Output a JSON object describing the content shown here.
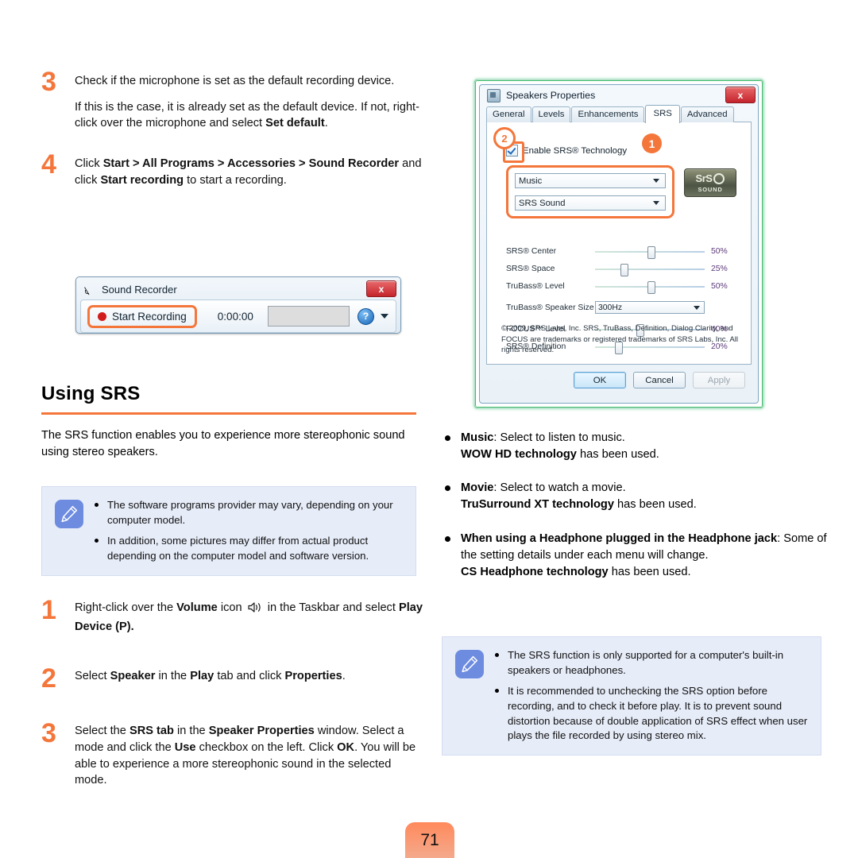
{
  "page": {
    "number": "71"
  },
  "left_column": {
    "step3": {
      "num": "3",
      "line1": "Check if the microphone is set as the default recording device.",
      "line2_a": "If this is the case, it is already set as the default device. If not, right-click over the microphone and select ",
      "line2_b": "Set default",
      "line2_c": "."
    },
    "step4": {
      "num": "4",
      "a": "Click ",
      "b": "Start > All Programs > Accessories > Sound Recorder",
      "c": " and click ",
      "d": "Start recording",
      "e": " to start a recording."
    }
  },
  "sound_recorder": {
    "title": "Sound Recorder",
    "close_label": "x",
    "record_button": "Start Recording",
    "record_button_accesskey": "S",
    "time": "0:00:00",
    "help_label": "?"
  },
  "using_srs": {
    "heading": "Using SRS",
    "paragraph": "The SRS function enables you to experience more stereophonic sound using stereo speakers.",
    "note": {
      "icon": "pencil-note-icon",
      "items": [
        "The software programs provider may vary, depending on your computer model.",
        "In addition, some pictures may differ from actual product depending on the computer model and software version."
      ]
    },
    "steps": [
      {
        "num": "1",
        "a": "Right-click over the ",
        "b": "Volume",
        "c": " icon ",
        "icon": "volume-speaker-icon",
        "d": " in the Taskbar and select ",
        "e": "Play Device (P).",
        "f": ""
      },
      {
        "num": "2",
        "a": "Select ",
        "b": "Speaker",
        "c": " in the ",
        "d": "Play",
        "e": " tab and click ",
        "f": "Properties",
        "g": "."
      },
      {
        "num": "3",
        "a": "Select the ",
        "b": "SRS tab",
        "c": " in the ",
        "d": "Speaker Properties",
        "e": " window. Select a mode and click the ",
        "f": "Use",
        "g": " checkbox on the left. Click ",
        "h": "OK",
        "i": ". You will be able to experience a more stereophonic sound in the selected mode."
      }
    ]
  },
  "speakers_properties": {
    "window_title": "Speakers Properties",
    "app_icon": "speaker-properties-icon",
    "close_label": "x",
    "tabs": [
      {
        "label": "General",
        "selected": false
      },
      {
        "label": "Levels",
        "selected": false
      },
      {
        "label": "Enhancements",
        "selected": false
      },
      {
        "label": "SRS",
        "selected": true
      },
      {
        "label": "Advanced",
        "selected": false
      }
    ],
    "enable_checkbox_label": "Enable SRS® Technology",
    "enable_checked": true,
    "callout_1": "1",
    "callout_2": "2",
    "mode_combo": "Music",
    "effect_combo": "SRS Sound",
    "logo": {
      "mark": "SrS",
      "sub": "SOUND"
    },
    "sliders": [
      {
        "label": "SRS® Center",
        "value": "50%",
        "pct": 50
      },
      {
        "label": "SRS® Space",
        "value": "25%",
        "pct": 25
      },
      {
        "label": "TruBass® Level",
        "value": "50%",
        "pct": 50
      }
    ],
    "speaker_size": {
      "label": "TruBass® Speaker Size",
      "value": "300Hz"
    },
    "sliders2": [
      {
        "label": "FOCUS™ Level",
        "value": "40%",
        "pct": 40
      },
      {
        "label": "SRS® Definition",
        "value": "20%",
        "pct": 20
      }
    ],
    "legal": "© 2009, SRS Labs, Inc.  SRS, TruBass, Definition, Dialog Clarity, and FOCUS are trademarks or registered trademarks of SRS Labs, Inc.  All rights reserved.",
    "buttons": {
      "ok": "OK",
      "cancel": "Cancel",
      "apply": "Apply"
    }
  },
  "right_column": {
    "bullets": [
      {
        "b1": "Music",
        "t1": ": Select to listen to music.",
        "b2": "WOW HD technology",
        "t2": " has been used."
      },
      {
        "b1": "Movie",
        "t1": ": Select to watch a movie.",
        "b2": "TruSurround XT technology",
        "t2": " has been used."
      },
      {
        "b1": "When using a Headphone plugged in the Headphone jack",
        "t1": ": Some of the setting details under each menu will change.",
        "b2": "CS Headphone technology",
        "t2": " has been used."
      }
    ],
    "note": {
      "icon": "pencil-note-icon",
      "items": [
        "The SRS function is only supported for a computer's built-in speakers or headphones.",
        "It is recommended to unchecking the SRS option before recording, and to check it before play. It is to prevent sound distortion because of double application of SRS effect when user plays the file recorded by using stereo mix."
      ]
    }
  },
  "colors": {
    "accent_orange": "#F4763B",
    "note_bg": "#E6ECF8",
    "note_icon_bg": "#6D8CE0",
    "dialog_glow_green": "#3FBF6E"
  }
}
